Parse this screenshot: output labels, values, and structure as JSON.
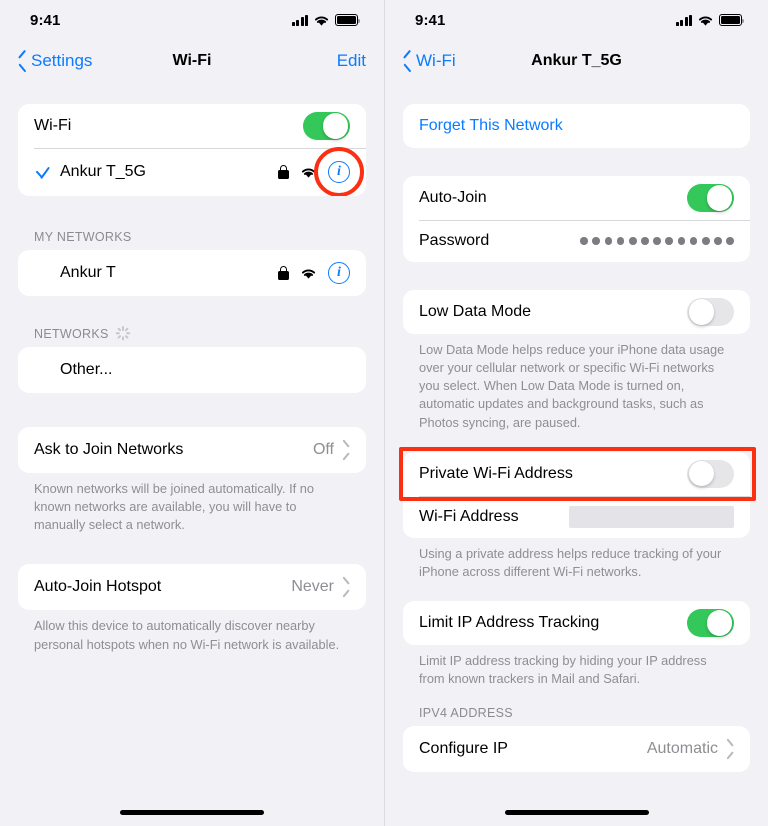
{
  "status_bar": {
    "time": "9:41",
    "icons": [
      "cellular-signal-icon",
      "wifi-icon",
      "battery-icon"
    ]
  },
  "left_screen": {
    "nav": {
      "back_label": "Settings",
      "title": "Wi-Fi",
      "action_label": "Edit"
    },
    "wifi_group": {
      "toggle_row": {
        "label": "Wi-Fi",
        "toggle": "on"
      },
      "connected_row": {
        "label": "Ankur T_5G",
        "checked": true,
        "secured": true,
        "signal": "wifi-icon",
        "info_button": "info-icon",
        "highlighted": true
      }
    },
    "my_networks": {
      "header": "MY NETWORKS",
      "rows": [
        {
          "label": "Ankur T",
          "secured": true,
          "signal": "wifi-icon",
          "info_button": "info-icon"
        }
      ]
    },
    "networks": {
      "header": "NETWORKS",
      "loading": true,
      "rows": [
        {
          "label": "Other..."
        }
      ]
    },
    "ask_to_join": {
      "label": "Ask to Join Networks",
      "value": "Off",
      "footnote": "Known networks will be joined automatically. If no known networks are available, you will have to manually select a network."
    },
    "auto_join_hotspot": {
      "label": "Auto-Join Hotspot",
      "value": "Never",
      "footnote": "Allow this device to automatically discover nearby personal hotspots when no Wi-Fi network is available."
    }
  },
  "right_screen": {
    "nav": {
      "back_label": "Wi-Fi",
      "title": "Ankur T_5G"
    },
    "forget": {
      "label": "Forget This Network"
    },
    "join_group": {
      "auto_join": {
        "label": "Auto-Join",
        "toggle": "on"
      },
      "password": {
        "label": "Password",
        "value_masked": "•••••••••••••",
        "dot_count": 13
      }
    },
    "low_data": {
      "label": "Low Data Mode",
      "toggle": "off",
      "footnote": "Low Data Mode helps reduce your iPhone data usage over your cellular network or specific Wi-Fi networks you select. When Low Data Mode is turned on, automatic updates and background tasks, such as Photos syncing, are paused."
    },
    "private_address": {
      "label": "Private Wi-Fi Address",
      "toggle": "off",
      "highlighted": true,
      "wifi_address": {
        "label": "Wi-Fi Address",
        "value": "",
        "redacted": true
      },
      "footnote": "Using a private address helps reduce tracking of your iPhone across different Wi-Fi networks."
    },
    "limit_ip": {
      "label": "Limit IP Address Tracking",
      "toggle": "on",
      "footnote": "Limit IP address tracking by hiding your IP address from known trackers in Mail and Safari."
    },
    "ipv4": {
      "header": "IPV4 ADDRESS",
      "configure_ip": {
        "label": "Configure IP",
        "value": "Automatic"
      }
    }
  },
  "colors": {
    "accent_blue": "#0a7cff",
    "toggle_on_green": "#34c759",
    "highlight_red": "#fb2f11",
    "background": "#f2f1f6",
    "secondary_text": "#8e8e93"
  }
}
